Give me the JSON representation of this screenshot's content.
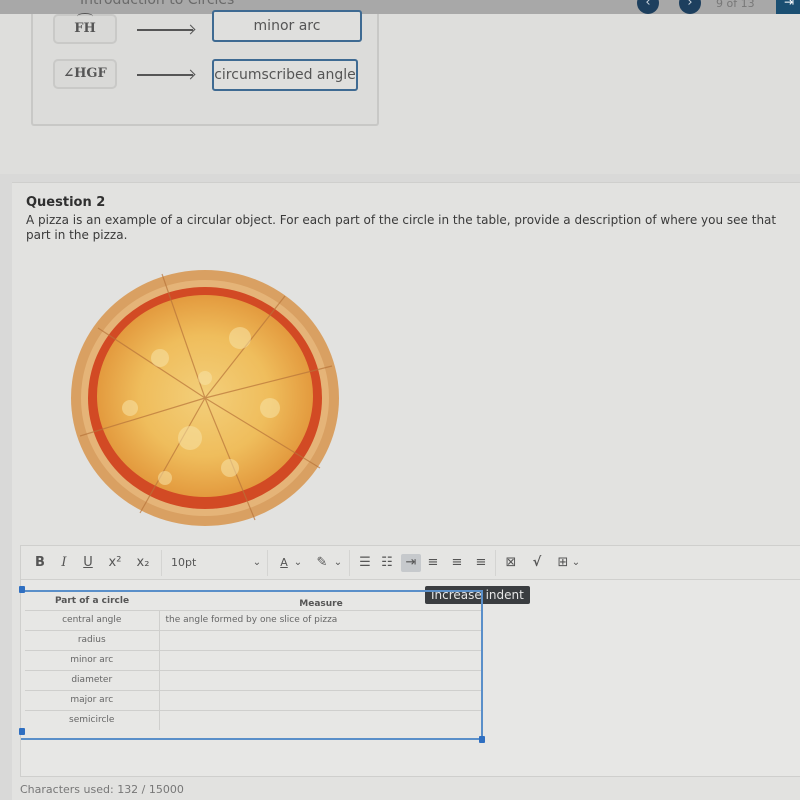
{
  "header": {
    "title": "Introduction to Circles",
    "prev_icon": "chevron-left-icon",
    "next_icon": "chevron-right-icon",
    "page_indicator": "9 of 13",
    "exit_icon": "exit-icon"
  },
  "question1": {
    "matches": [
      {
        "term": "FH",
        "term_decoration": "arc",
        "answer": "minor arc"
      },
      {
        "term": "∠HGF",
        "term_decoration": "none",
        "answer": "circumscribed angle"
      }
    ]
  },
  "question2": {
    "title": "Question 2",
    "prompt": "A pizza is an example of a circular object. For each part of the circle in the table, provide a description of where you see that part in the pizza.",
    "image_alt": "pizza"
  },
  "editor": {
    "toolbar": {
      "bold": "B",
      "italic": "I",
      "underline": "U",
      "superscript": "x²",
      "subscript": "x₂",
      "font_size": "10pt",
      "font_color_label": "A",
      "tooltip": "Increase indent"
    },
    "table": {
      "headers": [
        "Part of a circle",
        "Measure"
      ],
      "rows": [
        {
          "part": "central angle",
          "measure": "the angle formed by one slice of pizza"
        },
        {
          "part": "radius",
          "measure": ""
        },
        {
          "part": "minor arc",
          "measure": ""
        },
        {
          "part": "diameter",
          "measure": ""
        },
        {
          "part": "major arc",
          "measure": ""
        },
        {
          "part": "semicircle",
          "measure": ""
        }
      ]
    },
    "characters_used": "Characters used: 132 / 15000"
  },
  "colors": {
    "nav_button": "#1d3f5e",
    "answer_border": "#3e6a92",
    "selection": "#5a8fc9",
    "tooltip_bg": "#3a3d40"
  }
}
